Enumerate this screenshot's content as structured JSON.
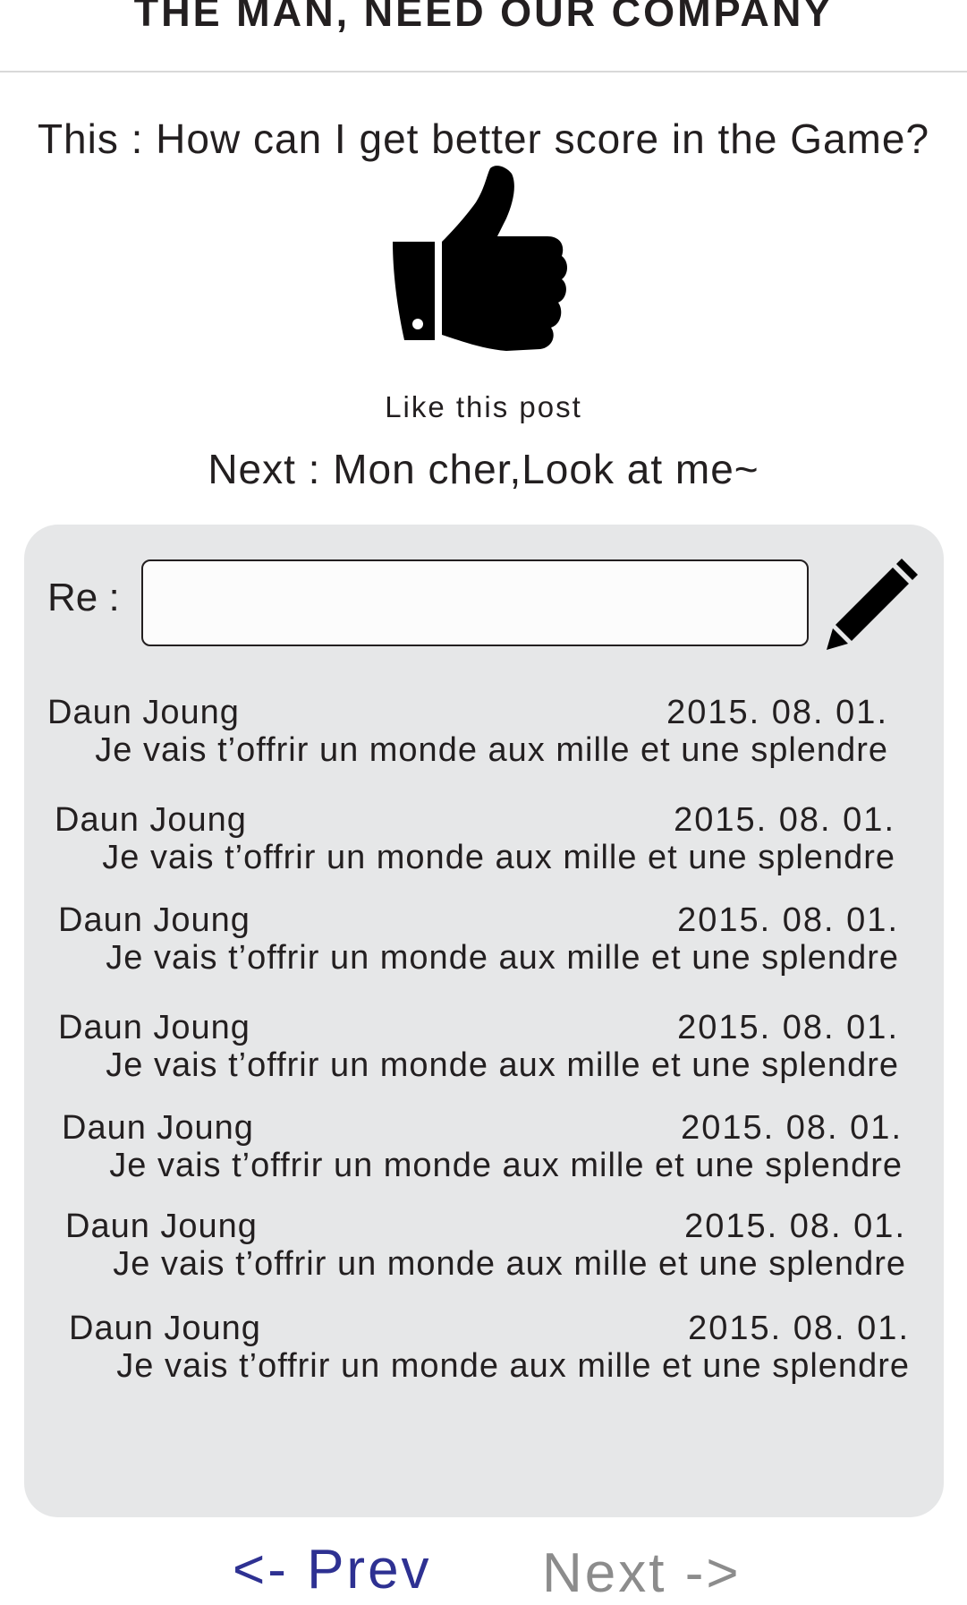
{
  "header": {
    "title": "THE MAN, NEED OUR COMPANY"
  },
  "post": {
    "title": "This : How can I get better score in the Game?",
    "like_label": "Like this post",
    "next_post": "Next : Mon cher,Look at me~"
  },
  "reply": {
    "label": "Re :",
    "value": "",
    "placeholder": ""
  },
  "comments": [
    {
      "author": "Daun Joung",
      "date": "2015. 08. 01.",
      "text": "Je vais t’offrir un monde aux mille et une splendre"
    },
    {
      "author": "Daun Joung",
      "date": "2015. 08. 01.",
      "text": "Je vais t’offrir un monde aux mille et une splendre"
    },
    {
      "author": "Daun Joung",
      "date": "2015. 08. 01.",
      "text": "Je vais t’offrir un monde aux mille et une splendre"
    },
    {
      "author": "Daun Joung",
      "date": "2015. 08. 01.",
      "text": "Je vais t’offrir un monde aux mille et une splendre"
    },
    {
      "author": "Daun Joung",
      "date": "2015. 08. 01.",
      "text": "Je vais t’offrir un monde aux mille et une splendre"
    },
    {
      "author": "Daun Joung",
      "date": "2015. 08. 01.",
      "text": "Je vais t’offrir un monde aux mille et une splendre"
    },
    {
      "author": "Daun Joung",
      "date": "2015. 08. 01.",
      "text": "Je vais t’offrir un monde aux mille et une splendre"
    }
  ],
  "pagination": {
    "prev_label": "<- Prev",
    "next_label": "Next ->"
  },
  "icons": {
    "like": "thumbs-up-icon",
    "submit": "pencil-icon"
  },
  "colors": {
    "text": "#231f20",
    "panel": "#e6e7e8",
    "prev_link": "#2e3192",
    "next_link_disabled": "#8c8c8c"
  }
}
